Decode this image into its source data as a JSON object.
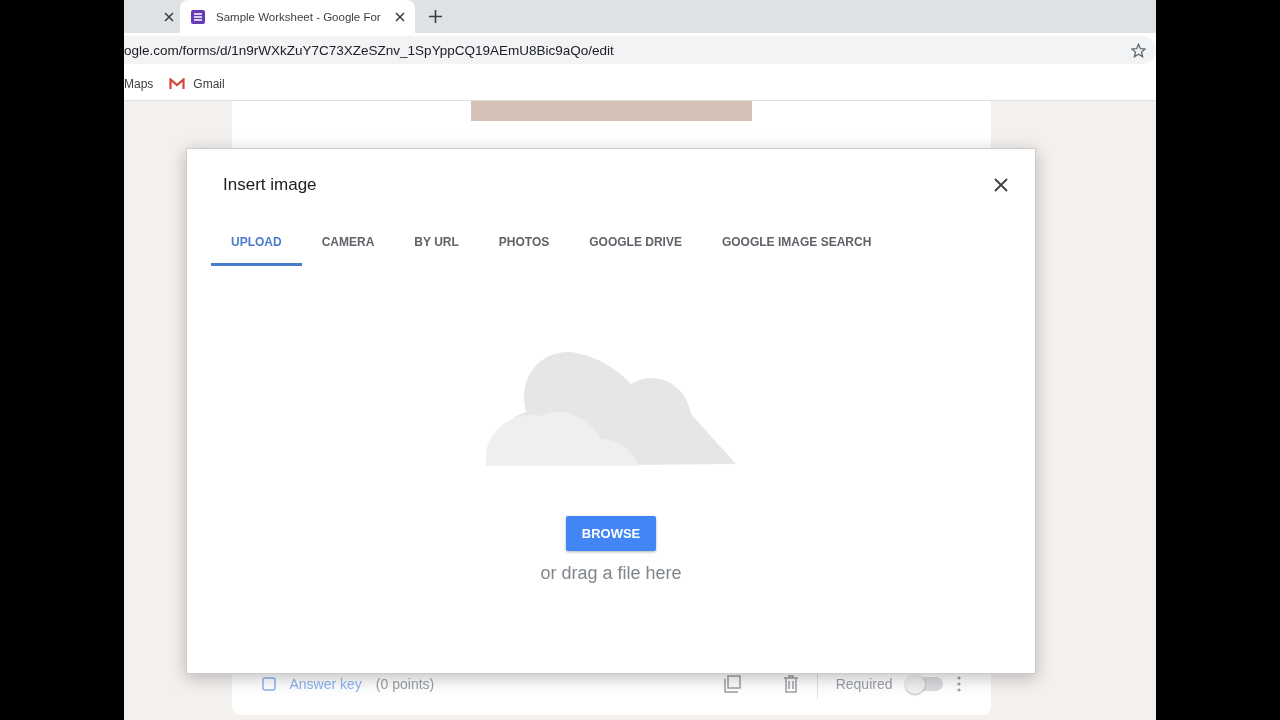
{
  "browser": {
    "tabs": [
      {
        "selected": false
      },
      {
        "title": "Sample Worksheet - Google For",
        "selected": true
      }
    ],
    "address": "ogle.com/forms/d/1n9rWXkZuY7C73XZeSZnv_1SpYppCQ19AEmU8Bic9aQo/edit",
    "bookmarks": [
      {
        "label": "Maps",
        "kind": "plain"
      },
      {
        "label": "Gmail",
        "kind": "mail"
      }
    ]
  },
  "dialog": {
    "title": "Insert image",
    "tabs": [
      {
        "label": "UPLOAD",
        "selected": true
      },
      {
        "label": "CAMERA",
        "selected": false
      },
      {
        "label": "BY URL",
        "selected": false
      },
      {
        "label": "PHOTOS",
        "selected": false
      },
      {
        "label": "GOOGLE DRIVE",
        "selected": false
      },
      {
        "label": "GOOGLE IMAGE SEARCH",
        "selected": false
      }
    ],
    "browse_button": "BROWSE",
    "drop_hint": "or drag a file here"
  },
  "question_footer": {
    "answer_key": "Answer key",
    "points": "(0 points)",
    "required_label": "Required",
    "required_on": false
  }
}
